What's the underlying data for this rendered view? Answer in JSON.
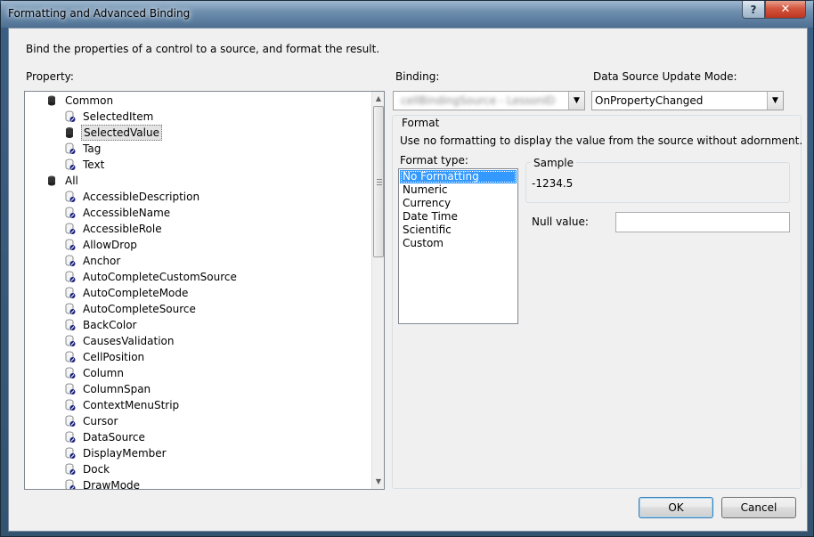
{
  "window": {
    "title": "Formatting and Advanced Binding",
    "help_label": "?",
    "close_label": "✕"
  },
  "description": "Bind the properties of a control to a source, and format the result.",
  "property": {
    "label": "Property:",
    "categories": [
      {
        "label": "Common",
        "items": [
          "SelectedItem",
          "SelectedValue",
          "Tag",
          "Text"
        ]
      },
      {
        "label": "All",
        "items": [
          "AccessibleDescription",
          "AccessibleName",
          "AccessibleRole",
          "AllowDrop",
          "Anchor",
          "AutoCompleteCustomSource",
          "AutoCompleteMode",
          "AutoCompleteSource",
          "BackColor",
          "CausesValidation",
          "CellPosition",
          "Column",
          "ColumnSpan",
          "ContextMenuStrip",
          "Cursor",
          "DataSource",
          "DisplayMember",
          "Dock",
          "DrawMode"
        ]
      }
    ],
    "selected_item": "SelectedValue"
  },
  "binding": {
    "label": "Binding:",
    "value": "cellBindingSource - LessonID"
  },
  "update_mode": {
    "label": "Data Source Update Mode:",
    "value": "OnPropertyChanged"
  },
  "format": {
    "group_label": "Format",
    "description": "Use no formatting to display the value from the source without adornment.",
    "type_label": "Format type:",
    "types": [
      "No Formatting",
      "Numeric",
      "Currency",
      "Date Time",
      "Scientific",
      "Custom"
    ],
    "selected_type": "No Formatting",
    "sample_label": "Sample",
    "sample_value": "-1234.5",
    "null_value_label": "Null value:",
    "null_value": ""
  },
  "buttons": {
    "ok": "OK",
    "cancel": "Cancel"
  },
  "colors": {
    "selection": "#3399ff",
    "default_button_border": "#3c7fb1"
  }
}
